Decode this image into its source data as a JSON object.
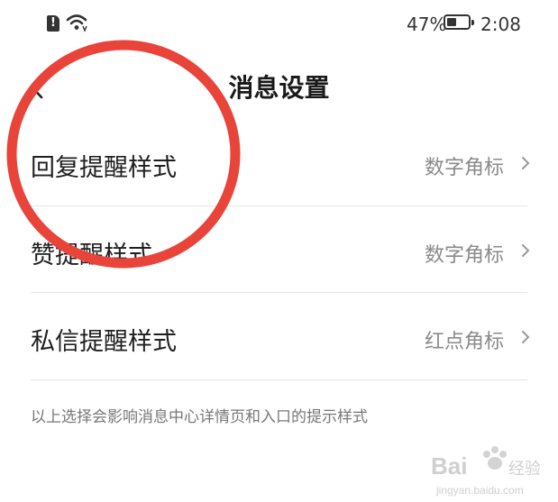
{
  "status_bar": {
    "battery_percent": "47%",
    "battery_level": 0.47,
    "time": "2:08"
  },
  "header": {
    "title": "消息设置"
  },
  "settings": [
    {
      "label": "回复提醒样式",
      "value": "数字角标"
    },
    {
      "label": "赞提醒样式",
      "value": "数字角标"
    },
    {
      "label": "私信提醒样式",
      "value": "红点角标"
    }
  ],
  "note": "以上选择会影响消息中心详情页和入口的提示样式",
  "watermark": {
    "logo_text": "Baidu经验",
    "url": "jingyan.baidu.com"
  },
  "colors": {
    "annotation_red": "#e8443a",
    "muted_text": "#8a8a8a"
  }
}
